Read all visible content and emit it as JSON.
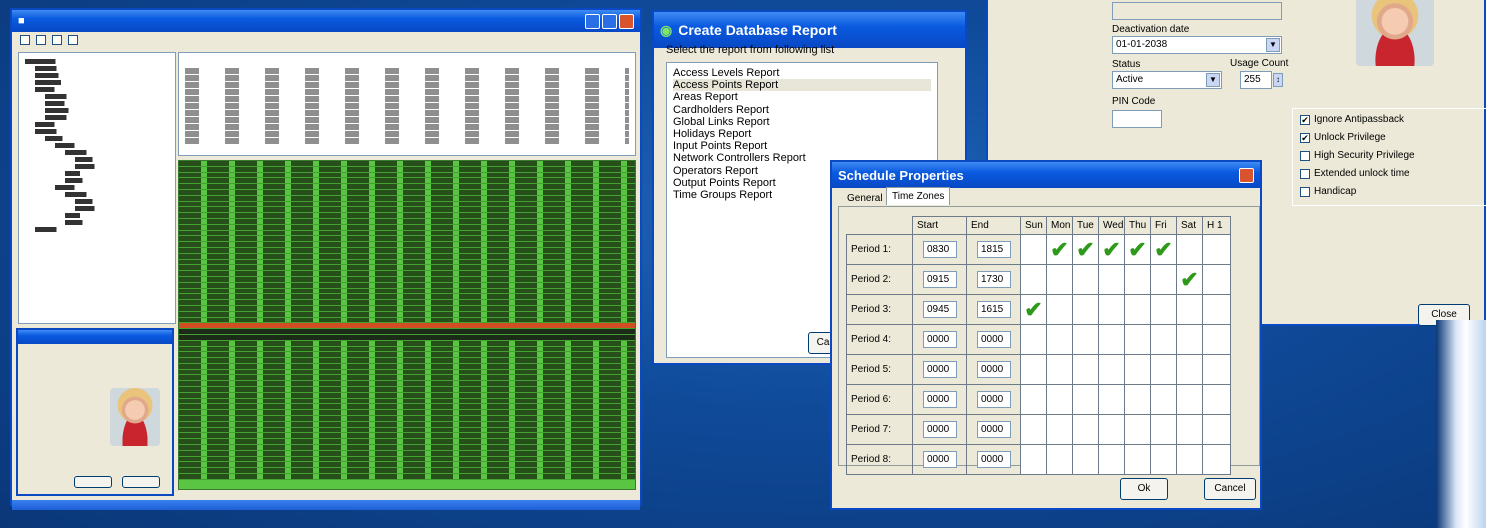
{
  "report_dialog": {
    "title": "Create Database Report",
    "prompt": "Select the report from following list",
    "items": [
      "Access Levels Report",
      "Access Points Report",
      "Areas Report",
      "Cardholders Report",
      "Global Links Report",
      "Holidays Report",
      "Input Points Report",
      "Network Controllers Report",
      "Operators Report",
      "Output Points Report",
      "Time Groups Report"
    ],
    "selected_index": 1,
    "cancel_label": "Ca"
  },
  "cardholder_dialog": {
    "deactivation_label": "Deactivation date",
    "deactivation_value": "01-01-2038",
    "status_label": "Status",
    "status_value": "Active",
    "usage_label": "Usage Count",
    "usage_value": "255",
    "pin_label": "PIN Code",
    "options": [
      {
        "label": "Ignore Antipassback",
        "checked": true
      },
      {
        "label": "Unlock Privilege",
        "checked": true
      },
      {
        "label": "High Security Privilege",
        "checked": false
      },
      {
        "label": "Extended unlock time",
        "checked": false
      },
      {
        "label": "Handicap",
        "checked": false
      }
    ],
    "close_label": "Close"
  },
  "schedule_dialog": {
    "title": "Schedule Properties",
    "tabs": [
      "General",
      "Time Zones"
    ],
    "active_tab": "Time Zones",
    "headers": [
      "Start",
      "End",
      "Sun",
      "Mon",
      "Tue",
      "Wed",
      "Thu",
      "Fri",
      "Sat",
      "H 1"
    ],
    "periods": [
      {
        "label": "Period 1:",
        "start": "0830",
        "end": "1815",
        "days": [
          false,
          true,
          true,
          true,
          true,
          true,
          false,
          false
        ]
      },
      {
        "label": "Period 2:",
        "start": "0915",
        "end": "1730",
        "days": [
          false,
          false,
          false,
          false,
          false,
          false,
          true,
          false
        ]
      },
      {
        "label": "Period 3:",
        "start": "0945",
        "end": "1615",
        "days": [
          true,
          false,
          false,
          false,
          false,
          false,
          false,
          false
        ]
      },
      {
        "label": "Period 4:",
        "start": "0000",
        "end": "0000",
        "days": [
          false,
          false,
          false,
          false,
          false,
          false,
          false,
          false
        ]
      },
      {
        "label": "Period 5:",
        "start": "0000",
        "end": "0000",
        "days": [
          false,
          false,
          false,
          false,
          false,
          false,
          false,
          false
        ]
      },
      {
        "label": "Period 6:",
        "start": "0000",
        "end": "0000",
        "days": [
          false,
          false,
          false,
          false,
          false,
          false,
          false,
          false
        ]
      },
      {
        "label": "Period 7:",
        "start": "0000",
        "end": "0000",
        "days": [
          false,
          false,
          false,
          false,
          false,
          false,
          false,
          false
        ]
      },
      {
        "label": "Period 8:",
        "start": "0000",
        "end": "0000",
        "days": [
          false,
          false,
          false,
          false,
          false,
          false,
          false,
          false
        ]
      }
    ],
    "ok_label": "Ok",
    "cancel_label": "Cancel"
  },
  "icons": {
    "check": "✔",
    "report_app": "database-icon"
  },
  "colors": {
    "log_green": "#5ac543",
    "alarm_red": "#e53a1d",
    "title_blue": "#0a5ae0",
    "check_green": "#2e9a1a"
  }
}
